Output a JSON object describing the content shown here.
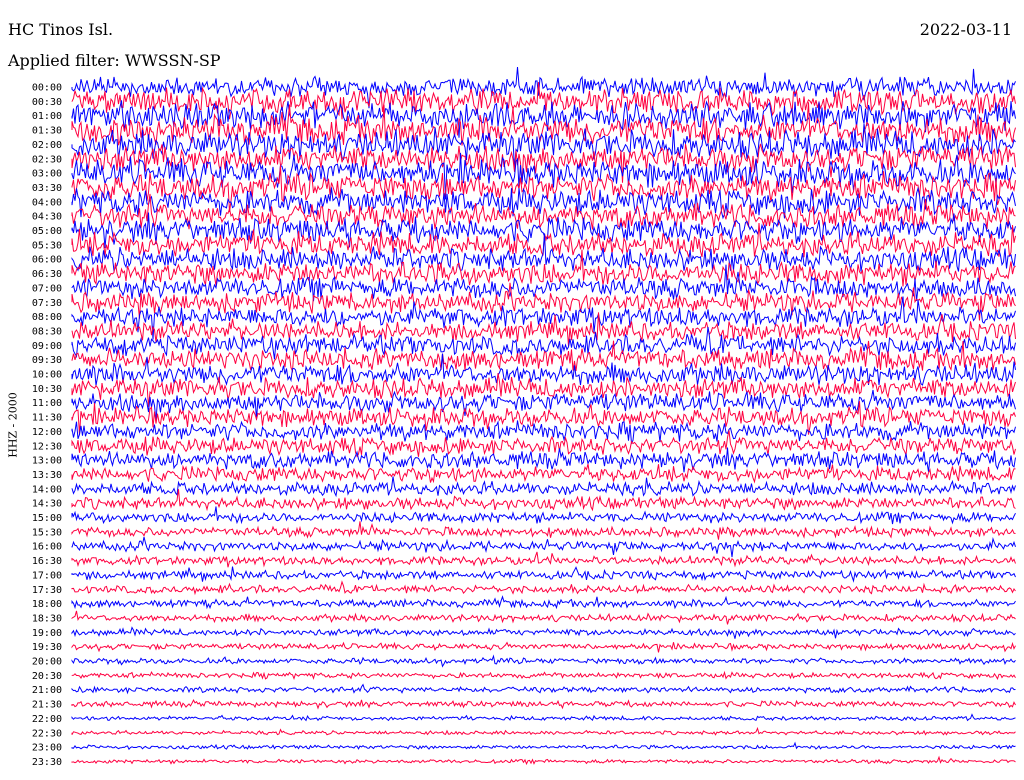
{
  "header": {
    "station": "HC Tinos Isl.",
    "date": "2022-03-11",
    "filter": "Applied filter: WWSSN-SP"
  },
  "chart_data": {
    "type": "line",
    "title": "HC Tinos Isl.",
    "subtitle": "Applied filter: WWSSN-SP",
    "date": "2022-03-11",
    "ylabel": "HHZ - 2000",
    "xlabel": "",
    "grid": false,
    "row_labels": [
      "00:00",
      "00:30",
      "01:00",
      "01:30",
      "02:00",
      "02:30",
      "03:00",
      "03:30",
      "04:00",
      "04:30",
      "05:00",
      "05:30",
      "06:00",
      "06:30",
      "07:00",
      "07:30",
      "08:00",
      "08:30",
      "09:00",
      "09:30",
      "10:00",
      "10:30",
      "11:00",
      "11:30",
      "12:00",
      "12:30",
      "13:00",
      "13:30",
      "14:00",
      "14:30",
      "15:00",
      "15:30",
      "16:00",
      "16:30",
      "17:00",
      "17:30",
      "18:00",
      "18:30",
      "19:00",
      "19:30",
      "20:00",
      "20:30",
      "21:00",
      "21:30",
      "22:00",
      "22:30",
      "23:00",
      "23:30"
    ],
    "colors": [
      "#0000ff",
      "#ff0040"
    ],
    "relative_amplitude": [
      1.0,
      1.3,
      1.4,
      1.5,
      1.5,
      1.4,
      1.45,
      1.4,
      1.35,
      1.3,
      1.3,
      1.25,
      1.2,
      1.2,
      1.1,
      1.05,
      1.05,
      1.0,
      1.05,
      1.1,
      1.1,
      1.1,
      1.0,
      1.0,
      0.95,
      0.9,
      0.9,
      0.8,
      0.7,
      0.65,
      0.55,
      0.5,
      0.5,
      0.45,
      0.45,
      0.42,
      0.4,
      0.38,
      0.35,
      0.32,
      0.3,
      0.28,
      0.3,
      0.3,
      0.22,
      0.2,
      0.2,
      0.2
    ]
  }
}
